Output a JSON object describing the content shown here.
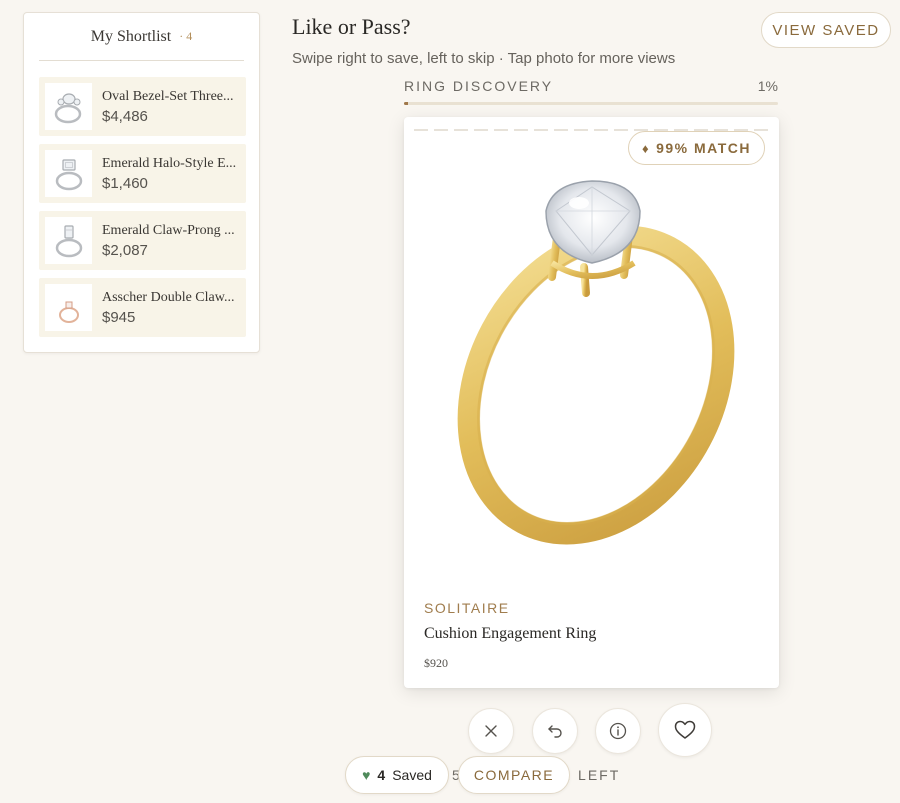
{
  "shortlist": {
    "title": "My Shortlist",
    "count": "· 4",
    "items": [
      {
        "name": "Oval Bezel-Set Three...",
        "price": "$4,486",
        "metal": "white"
      },
      {
        "name": "Emerald Halo-Style E...",
        "price": "$1,460",
        "metal": "white"
      },
      {
        "name": "Emerald Claw-Prong ...",
        "price": "$2,087",
        "metal": "white"
      },
      {
        "name": "Asscher Double Claw...",
        "price": "$945",
        "metal": "rose"
      }
    ]
  },
  "header": {
    "title": "Like or Pass?",
    "subtitle": "Swipe right to save, left to skip · Tap photo for more views",
    "view_saved": "VIEW SAVED"
  },
  "progress": {
    "label": "RING DISCOVERY",
    "percent_text": "1%",
    "fraction": 0.01
  },
  "card": {
    "match": "99% MATCH",
    "match_icon": "diamond-icon",
    "category": "SOLITAIRE",
    "name": "Cushion Engagement Ring",
    "price": "$920",
    "image": "yellow-gold-solitaire-ring"
  },
  "actions": [
    {
      "name": "pass-button",
      "icon": "close-icon"
    },
    {
      "name": "undo-button",
      "icon": "undo-icon"
    },
    {
      "name": "info-button",
      "icon": "info-icon"
    },
    {
      "name": "like-button",
      "icon": "heart-icon"
    }
  ],
  "footer": {
    "saved_count": "4",
    "saved_label": "Saved",
    "compare": "COMPARE",
    "stats": "5 SAVED • 402 LEFT"
  },
  "colors": {
    "background": "#f9f6f1",
    "accent": "#8a6a3c",
    "gold": "#e7c564",
    "saved_heart": "#4f8a5b"
  }
}
